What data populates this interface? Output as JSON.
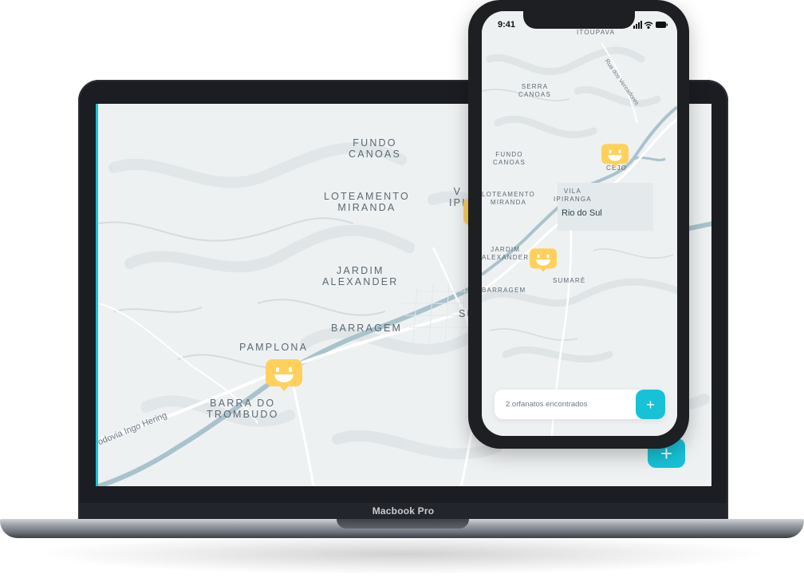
{
  "laptop": {
    "brand": "Macbook Pro",
    "map_labels": [
      {
        "id": "fundo-canoas",
        "lines": [
          "FUNDO",
          "CANOAS"
        ]
      },
      {
        "id": "loteamento-miranda",
        "lines": [
          "LOTEAMENTO",
          "MIRANDA"
        ]
      },
      {
        "id": "jardim-alexander",
        "lines": [
          "JARDIM",
          "ALEXANDER"
        ]
      },
      {
        "id": "barragem",
        "lines": [
          "BARRAGEM"
        ]
      },
      {
        "id": "pamplona",
        "lines": [
          "PAMPLONA"
        ]
      },
      {
        "id": "barra-do-trombudo",
        "lines": [
          "BARRA DO",
          "TROMBUDO"
        ]
      },
      {
        "id": "vila-ipiranga-partial",
        "lines": [
          "V",
          "IPI"
        ]
      },
      {
        "id": "sumare-partial",
        "lines": [
          "SU"
        ]
      }
    ],
    "road_label": "odovia Ingo Hering",
    "add_button_label": "+"
  },
  "phone": {
    "status_time": "9:41",
    "map_labels": [
      {
        "id": "itoupava",
        "lines": [
          "ITOUPAVA"
        ]
      },
      {
        "id": "serra-canoas",
        "lines": [
          "SERRA",
          "CANOAS"
        ]
      },
      {
        "id": "fundo-canoas",
        "lines": [
          "FUNDO",
          "CANOAS"
        ]
      },
      {
        "id": "loteamento-miranda",
        "lines": [
          "LOTEAMENTO",
          "MIRANDA"
        ]
      },
      {
        "id": "vila-ipiranga",
        "lines": [
          "VILA",
          "IPIRANGA"
        ]
      },
      {
        "id": "jardim-alexander",
        "lines": [
          "JARDIM",
          "ALEXANDER"
        ]
      },
      {
        "id": "sumare",
        "lines": [
          "SUMARÉ"
        ]
      },
      {
        "id": "barragem",
        "lines": [
          "BARRAGEM"
        ]
      },
      {
        "id": "centro-partial",
        "lines": [
          "CEJO"
        ]
      }
    ],
    "city_label": "Rio do Sul",
    "road_label": "Rua dos Vereadores",
    "footer_text": "2 orfanatos encontrados",
    "add_button_label": "+"
  },
  "colors": {
    "accent": "#17c2d7",
    "pin": "#ffd15c",
    "map_bg": "#eef1f2",
    "river": "#a9c3cc"
  },
  "icons": [
    "orphanage-pin-icon",
    "plus-icon",
    "signal-icon",
    "wifi-icon",
    "battery-icon"
  ]
}
